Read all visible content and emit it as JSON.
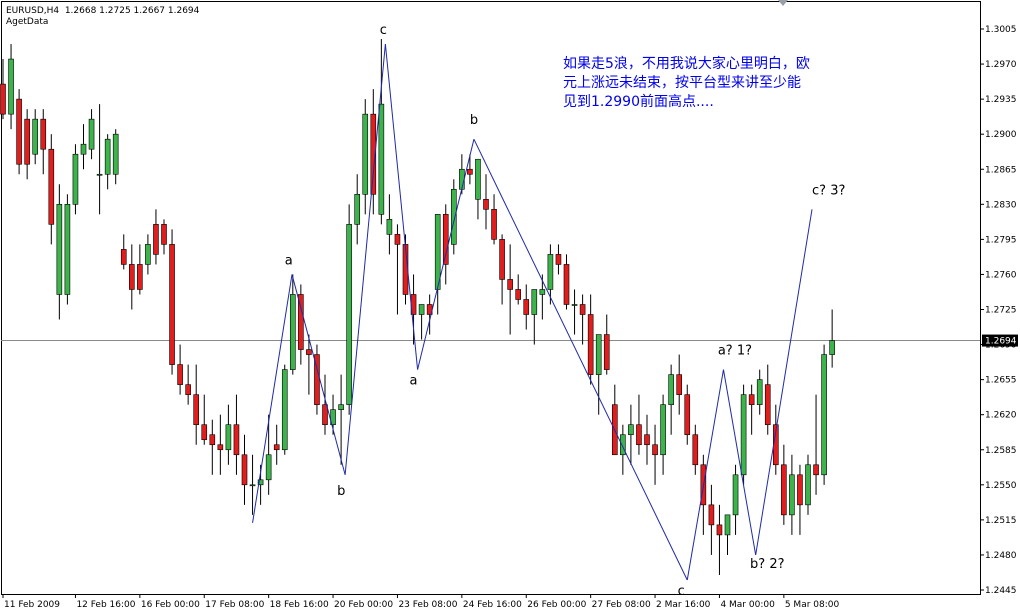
{
  "header": {
    "symbol_line": "EURUSD,H4  1.2668 1.2725 1.2667 1.2694",
    "indicator": "AgetData"
  },
  "annotation": {
    "lines": [
      "如果走5浪，不用我说大家心里明白，欧",
      "元上涨远未结束，按平台型来讲至少能",
      "见到1.2990前面高点...."
    ],
    "color": "#0000ee"
  },
  "colors": {
    "bull": "#3cb44b",
    "bear": "#e11d1d",
    "wave": "#1e2aa8",
    "grid": "#000000",
    "price_tag_bg": "#000000",
    "price_tag_fg": "#ffffff"
  },
  "chart_data": {
    "type": "candlestick",
    "symbol": "EURUSD",
    "timeframe": "H4",
    "ylim": [
      1.2445,
      1.3305
    ],
    "y_ticks": [
      "1.3005",
      "1.2970",
      "1.2935",
      "1.2900",
      "1.2865",
      "1.2830",
      "1.2795",
      "1.2760",
      "1.2725",
      "1.2690",
      "1.2655",
      "1.2620",
      "1.2585",
      "1.2550",
      "1.2515",
      "1.2480",
      "1.2445"
    ],
    "current_price": "1.2694",
    "x_ticks": [
      {
        "bar": 0,
        "label": "11 Feb 2009"
      },
      {
        "bar": 9,
        "label": "12 Feb 16:00"
      },
      {
        "bar": 17,
        "label": "16 Feb 00:00"
      },
      {
        "bar": 25,
        "label": "17 Feb 08:00"
      },
      {
        "bar": 33,
        "label": "18 Feb 16:00"
      },
      {
        "bar": 41,
        "label": "20 Feb 00:00"
      },
      {
        "bar": 49,
        "label": "23 Feb 08:00"
      },
      {
        "bar": 57,
        "label": "24 Feb 16:00"
      },
      {
        "bar": 65,
        "label": "26 Feb 00:00"
      },
      {
        "bar": 73,
        "label": "27 Feb 08:00"
      },
      {
        "bar": 81,
        "label": "2 Mar 16:00"
      },
      {
        "bar": 89,
        "label": "4 Mar 00:00"
      },
      {
        "bar": 97,
        "label": "5 Mar 08:00"
      }
    ],
    "candles": [
      [
        1.295,
        1.2975,
        1.2915,
        1.292
      ],
      [
        1.292,
        1.299,
        1.2905,
        1.2975
      ],
      [
        1.2935,
        1.2945,
        1.286,
        1.287
      ],
      [
        1.2915,
        1.2925,
        1.2855,
        1.287
      ],
      [
        1.288,
        1.2925,
        1.287,
        1.2915
      ],
      [
        1.2915,
        1.2925,
        1.286,
        1.2885
      ],
      [
        1.2885,
        1.29,
        1.279,
        1.281
      ],
      [
        1.274,
        1.285,
        1.2715,
        1.283
      ],
      [
        1.274,
        1.284,
        1.273,
        1.283
      ],
      [
        1.283,
        1.289,
        1.282,
        1.288
      ],
      [
        1.288,
        1.291,
        1.2865,
        1.289
      ],
      [
        1.2885,
        1.2925,
        1.2875,
        1.2915
      ],
      [
        1.286,
        1.293,
        1.282,
        1.286
      ],
      [
        1.286,
        1.29,
        1.2845,
        1.2895
      ],
      [
        1.286,
        1.2905,
        1.285,
        1.29
      ],
      [
        1.2785,
        1.28,
        1.2765,
        1.277
      ],
      [
        1.277,
        1.279,
        1.2725,
        1.2745
      ],
      [
        1.277,
        1.279,
        1.274,
        1.2745
      ],
      [
        1.277,
        1.28,
        1.276,
        1.279
      ],
      [
        1.281,
        1.2825,
        1.277,
        1.278
      ],
      [
        1.281,
        1.2815,
        1.278,
        1.279
      ],
      [
        1.279,
        1.2805,
        1.266,
        1.267
      ],
      [
        1.267,
        1.269,
        1.264,
        1.265
      ],
      [
        1.265,
        1.267,
        1.263,
        1.264
      ],
      [
        1.264,
        1.267,
        1.259,
        1.261
      ],
      [
        1.261,
        1.264,
        1.259,
        1.2595
      ],
      [
        1.26,
        1.2615,
        1.256,
        1.259
      ],
      [
        1.259,
        1.262,
        1.256,
        1.2585
      ],
      [
        1.2585,
        1.263,
        1.257,
        1.261
      ],
      [
        1.261,
        1.264,
        1.256,
        1.258
      ],
      [
        1.258,
        1.26,
        1.253,
        1.255
      ],
      [
        1.255,
        1.258,
        1.252,
        1.255
      ],
      [
        1.255,
        1.257,
        1.253,
        1.2555
      ],
      [
        1.2555,
        1.262,
        1.254,
        1.258
      ],
      [
        1.259,
        1.261,
        1.257,
        1.2585
      ],
      [
        1.2585,
        1.267,
        1.258,
        1.2665
      ],
      [
        1.2665,
        1.276,
        1.266,
        1.274
      ],
      [
        1.274,
        1.275,
        1.267,
        1.2685
      ],
      [
        1.2685,
        1.27,
        1.264,
        1.268
      ],
      [
        1.268,
        1.269,
        1.262,
        1.263
      ],
      [
        1.263,
        1.266,
        1.26,
        1.261
      ],
      [
        1.261,
        1.264,
        1.26,
        1.2625
      ],
      [
        1.2625,
        1.266,
        1.257,
        1.263
      ],
      [
        1.263,
        1.283,
        1.262,
        1.281
      ],
      [
        1.281,
        1.286,
        1.279,
        1.284
      ],
      [
        1.284,
        1.2935,
        1.282,
        1.292
      ],
      [
        1.292,
        1.2945,
        1.282,
        1.284
      ],
      [
        1.282,
        1.2995,
        1.281,
        1.293
      ],
      [
        1.28,
        1.284,
        1.278,
        1.2815
      ],
      [
        1.28,
        1.281,
        1.272,
        1.279
      ],
      [
        1.279,
        1.28,
        1.273,
        1.274
      ],
      [
        1.274,
        1.276,
        1.269,
        1.272
      ],
      [
        1.272,
        1.273,
        1.2695,
        1.273
      ],
      [
        1.273,
        1.274,
        1.27,
        1.272
      ],
      [
        1.2745,
        1.2815,
        1.272,
        1.282
      ],
      [
        1.282,
        1.283,
        1.275,
        1.277
      ],
      [
        1.279,
        1.2855,
        1.278,
        1.2845
      ],
      [
        1.2845,
        1.288,
        1.284,
        1.2865
      ],
      [
        1.2865,
        1.288,
        1.285,
        1.286
      ],
      [
        1.2835,
        1.2875,
        1.2815,
        1.2875
      ],
      [
        1.2835,
        1.286,
        1.2805,
        1.2825
      ],
      [
        1.2825,
        1.284,
        1.279,
        1.2795
      ],
      [
        1.2795,
        1.28,
        1.273,
        1.2755
      ],
      [
        1.2755,
        1.279,
        1.27,
        1.2745
      ],
      [
        1.2745,
        1.276,
        1.273,
        1.2735
      ],
      [
        1.2735,
        1.275,
        1.2705,
        1.272
      ],
      [
        1.272,
        1.274,
        1.269,
        1.2745
      ],
      [
        1.274,
        1.276,
        1.2715,
        1.2745
      ],
      [
        1.2745,
        1.279,
        1.273,
        1.278
      ],
      [
        1.278,
        1.279,
        1.276,
        1.277
      ],
      [
        1.277,
        1.278,
        1.2725,
        1.273
      ],
      [
        1.273,
        1.2745,
        1.27,
        1.273
      ],
      [
        1.273,
        1.274,
        1.269,
        1.272
      ],
      [
        1.272,
        1.274,
        1.265,
        1.266
      ],
      [
        1.266,
        1.269,
        1.262,
        1.27
      ],
      [
        1.27,
        1.272,
        1.266,
        1.2665
      ],
      [
        1.263,
        1.265,
        1.258,
        1.258
      ],
      [
        1.258,
        1.261,
        1.256,
        1.26
      ],
      [
        1.26,
        1.263,
        1.257,
        1.261
      ],
      [
        1.261,
        1.264,
        1.258,
        1.259
      ],
      [
        1.26,
        1.262,
        1.257,
        1.259
      ],
      [
        1.259,
        1.261,
        1.255,
        1.258
      ],
      [
        1.258,
        1.264,
        1.256,
        1.263
      ],
      [
        1.263,
        1.267,
        1.26,
        1.266
      ],
      [
        1.266,
        1.268,
        1.262,
        1.264
      ],
      [
        1.264,
        1.265,
        1.259,
        1.26
      ],
      [
        1.26,
        1.261,
        1.256,
        1.257
      ],
      [
        1.257,
        1.258,
        1.25,
        1.253
      ],
      [
        1.253,
        1.255,
        1.248,
        1.251
      ],
      [
        1.251,
        1.253,
        1.246,
        1.25
      ],
      [
        1.25,
        1.252,
        1.248,
        1.252
      ],
      [
        1.252,
        1.257,
        1.25,
        1.256
      ],
      [
        1.256,
        1.265,
        1.255,
        1.264
      ],
      [
        1.264,
        1.265,
        1.26,
        1.263
      ],
      [
        1.263,
        1.2665,
        1.262,
        1.2655
      ],
      [
        1.265,
        1.267,
        1.26,
        1.261
      ],
      [
        1.261,
        1.263,
        1.256,
        1.257
      ],
      [
        1.257,
        1.259,
        1.251,
        1.252
      ],
      [
        1.252,
        1.258,
        1.25,
        1.256
      ],
      [
        1.256,
        1.257,
        1.25,
        1.253
      ],
      [
        1.253,
        1.258,
        1.252,
        1.257
      ],
      [
        1.257,
        1.264,
        1.254,
        1.256
      ],
      [
        1.256,
        1.269,
        1.255,
        1.268
      ],
      [
        1.268,
        1.2725,
        1.2667,
        1.2694
      ]
    ],
    "wave_points": [
      {
        "bar": 31.0,
        "price": 1.2512
      },
      {
        "bar": 35.9,
        "price": 1.276
      },
      {
        "bar": 42.5,
        "price": 1.256
      },
      {
        "bar": 47.5,
        "price": 1.299
      },
      {
        "bar": 51.5,
        "price": 1.2665
      },
      {
        "bar": 58.5,
        "price": 1.2895
      },
      {
        "bar": 85.0,
        "price": 1.2455
      },
      {
        "bar": 89.5,
        "price": 1.2665
      },
      {
        "bar": 93.5,
        "price": 1.248
      },
      {
        "bar": 100.5,
        "price": 1.2825
      }
    ],
    "wave_labels": [
      {
        "bar": 35.0,
        "price": 1.277,
        "text": "a"
      },
      {
        "bar": 41.5,
        "price": 1.254,
        "text": "b"
      },
      {
        "bar": 46.8,
        "price": 1.3,
        "text": "c"
      },
      {
        "bar": 50.5,
        "price": 1.265,
        "text": "a"
      },
      {
        "bar": 58.0,
        "price": 1.291,
        "text": "b"
      },
      {
        "bar": 83.8,
        "price": 1.244,
        "text": "c"
      },
      {
        "bar": 88.8,
        "price": 1.268,
        "text": "a?  1?"
      },
      {
        "bar": 92.8,
        "price": 1.2467,
        "text": "b?  2?"
      },
      {
        "bar": 100.5,
        "price": 1.284,
        "text": "c?  3?"
      }
    ]
  }
}
